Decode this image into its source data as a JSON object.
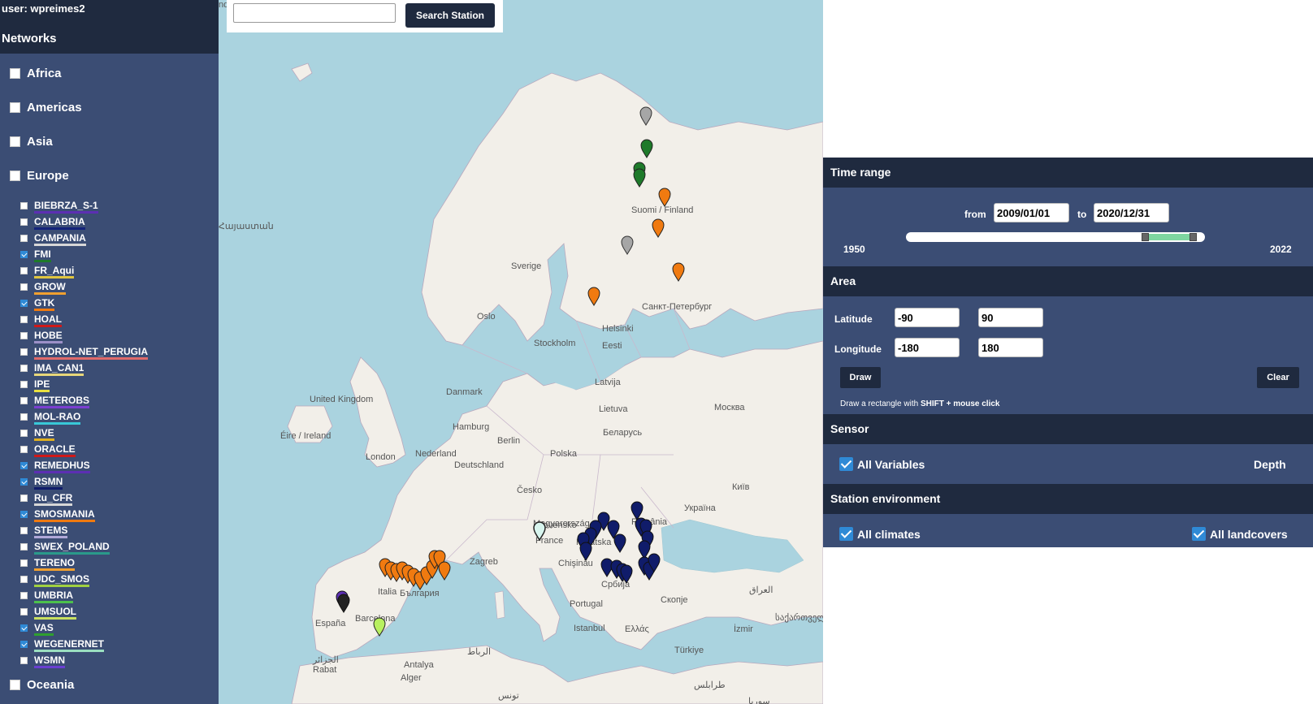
{
  "user": {
    "label": "user: wpreimes2"
  },
  "sidebar": {
    "title": "Networks",
    "regions": [
      {
        "label": "Africa",
        "checked": false
      },
      {
        "label": "Americas",
        "checked": false
      },
      {
        "label": "Asia",
        "checked": false
      },
      {
        "label": "Europe",
        "checked": false
      },
      {
        "label": "Oceania",
        "checked": false
      }
    ],
    "networks": [
      {
        "label": "BIEBRZA_S-1",
        "checked": false,
        "color": "#5c2fb3"
      },
      {
        "label": "CALABRIA",
        "checked": false,
        "color": "#14237a"
      },
      {
        "label": "CAMPANIA",
        "checked": false,
        "color": "#d7d7d7"
      },
      {
        "label": "FMI",
        "checked": true,
        "color": "#1e7a2a"
      },
      {
        "label": "FR_Aqui",
        "checked": false,
        "color": "#e0c640"
      },
      {
        "label": "GROW",
        "checked": false,
        "color": "#f0a030"
      },
      {
        "label": "GTK",
        "checked": true,
        "color": "#f07a10"
      },
      {
        "label": "HOAL",
        "checked": false,
        "color": "#d01818"
      },
      {
        "label": "HOBE",
        "checked": false,
        "color": "#9c90c8"
      },
      {
        "label": "HYDROL-NET_PERUGIA",
        "checked": false,
        "color": "#e06a6a"
      },
      {
        "label": "IMA_CAN1",
        "checked": false,
        "color": "#e8d77a"
      },
      {
        "label": "IPE",
        "checked": false,
        "color": "#e8df40"
      },
      {
        "label": "METEROBS",
        "checked": false,
        "color": "#7b3fd1"
      },
      {
        "label": "MOL-RAO",
        "checked": false,
        "color": "#38c8d8"
      },
      {
        "label": "NVE",
        "checked": false,
        "color": "#e0b020"
      },
      {
        "label": "ORACLE",
        "checked": false,
        "color": "#d01818"
      },
      {
        "label": "REMEDHUS",
        "checked": true,
        "color": "#5c2fb3"
      },
      {
        "label": "RSMN",
        "checked": true,
        "color": "#101c6a"
      },
      {
        "label": "Ru_CFR",
        "checked": false,
        "color": "#d7d7d7"
      },
      {
        "label": "SMOSMANIA",
        "checked": true,
        "color": "#f07a10"
      },
      {
        "label": "STEMS",
        "checked": false,
        "color": "#b0a8d8"
      },
      {
        "label": "SWEX_POLAND",
        "checked": false,
        "color": "#2a9a8a"
      },
      {
        "label": "TERENO",
        "checked": false,
        "color": "#f0a030"
      },
      {
        "label": "UDC_SMOS",
        "checked": false,
        "color": "#a0d040"
      },
      {
        "label": "UMBRIA",
        "checked": false,
        "color": "#4cc04c"
      },
      {
        "label": "UMSUOL",
        "checked": false,
        "color": "#c8e060"
      },
      {
        "label": "VAS",
        "checked": true,
        "color": "#2fa02f"
      },
      {
        "label": "WEGENERNET",
        "checked": true,
        "color": "#9adfc0"
      },
      {
        "label": "WSMN",
        "checked": false,
        "color": "#6a3fd1"
      }
    ]
  },
  "search": {
    "placeholder": "",
    "button_label": "Search Station"
  },
  "map": {
    "labels": [
      "Sverige",
      "Suomi / Finland",
      "Oslo",
      "Stockholm",
      "Helsinki",
      "Санкт-Петербург",
      "Eesti",
      "Latvija",
      "Lietuva",
      "Danmark",
      "United Kingdom",
      "Éire / Ireland",
      "London",
      "Nederland",
      "Hamburg",
      "Berlin",
      "Deutschland",
      "Polska",
      "Беларусь",
      "Москва",
      "Київ",
      "Україна",
      "Česko",
      "Slovensko",
      "Magyarország",
      "France",
      "Zagreb",
      "Hrvatska",
      "România",
      "Chişinău",
      "Србија",
      "България",
      "Italia",
      "Barcelona",
      "España",
      "Portugal",
      "Скопје",
      "Istanbul",
      "Ελλάς",
      "İzmir",
      "Türkiye",
      "Antalya",
      "Alger",
      "الجزائر",
      "Rabat",
      "الرباط",
      "تونس",
      "طرابلس",
      "سوريا",
      "العراق",
      "საქართველო",
      "Հայաստան",
      "nd"
    ]
  },
  "panel": {
    "time_range": {
      "title": "Time range",
      "from_label": "from",
      "from_value": "2009/01/01",
      "to_label": "to",
      "to_value": "2020/12/31",
      "min_year": "1950",
      "max_year": "2022"
    },
    "area": {
      "title": "Area",
      "lat_label": "Latitude",
      "lat_min": "-90",
      "lat_max": "90",
      "lon_label": "Longitude",
      "lon_min": "-180",
      "lon_max": "180",
      "draw_label": "Draw",
      "clear_label": "Clear",
      "hint_prefix": "Draw a rectangle with ",
      "hint_bold": "SHIFT + mouse click"
    },
    "sensor": {
      "title": "Sensor",
      "all_variables": "All Variables",
      "depth": "Depth"
    },
    "station_env": {
      "title": "Station environment",
      "all_climates": "All climates",
      "all_landcovers": "All landcovers"
    }
  },
  "colors": {
    "dark": "#1f2a3f",
    "panel": "#3b4d74",
    "water": "#aad3df",
    "land": "#f2efe9",
    "checkbox": "#2f8ad6"
  }
}
